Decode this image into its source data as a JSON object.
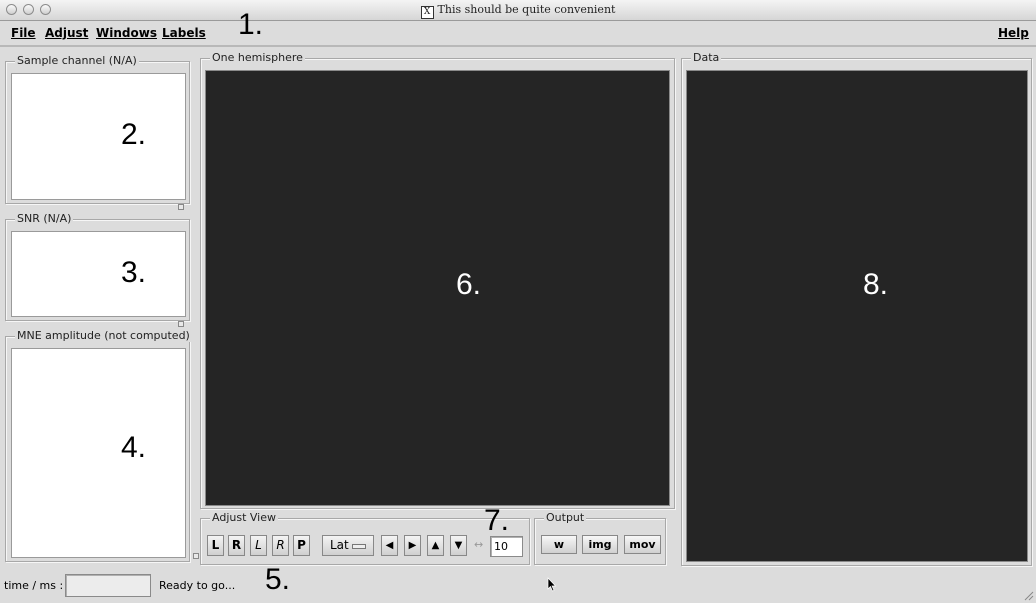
{
  "window": {
    "title": "This should be quite convenient"
  },
  "menubar": {
    "items": [
      {
        "label": "File"
      },
      {
        "label": "Adjust"
      },
      {
        "label": "Windows"
      },
      {
        "label": "Labels"
      }
    ],
    "help": "Help"
  },
  "annotations": [
    "1.",
    "2.",
    "3.",
    "4.",
    "5.",
    "6.",
    "7.",
    "8."
  ],
  "left_panels": {
    "sample_channel": "Sample channel (N/A)",
    "snr": "SNR (N/A)",
    "mne_amplitude": "MNE amplitude (not computed)"
  },
  "center": {
    "title": "One hemisphere"
  },
  "right": {
    "title": "Data"
  },
  "adjust_view": {
    "title": "Adjust View",
    "buttons": [
      "L",
      "R",
      "L",
      "R",
      "P"
    ],
    "dropdown_value": "Lat",
    "step_value": "10"
  },
  "output": {
    "title": "Output",
    "buttons": [
      "w",
      "img",
      "mov"
    ]
  },
  "status": {
    "time_label": "time / ms :",
    "time_value": "",
    "message": "Ready to go..."
  },
  "icons": {
    "arrows": [
      "left-arrow-icon",
      "right-arrow-icon",
      "up-arrow-icon",
      "down-arrow-icon"
    ],
    "step": "step-arrows-icon",
    "resize": "resize-grip-icon",
    "cursor": "mouse-pointer-icon"
  }
}
